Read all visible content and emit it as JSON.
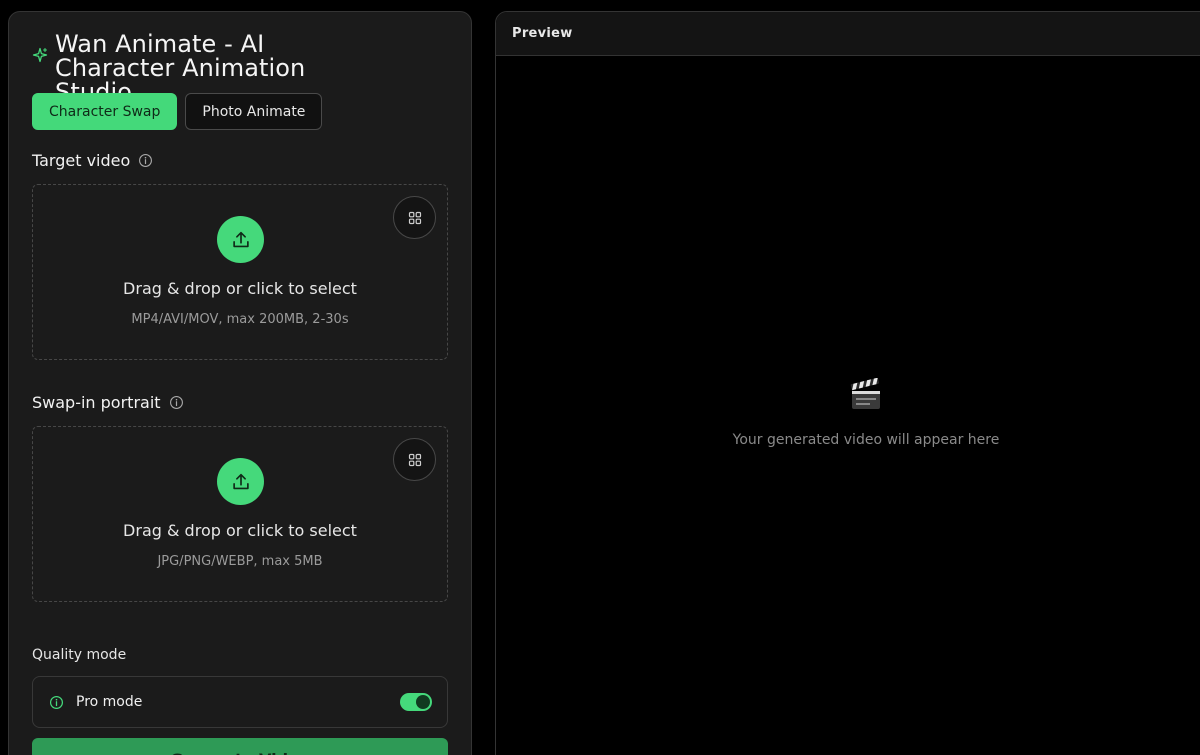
{
  "app": {
    "title": "Wan Animate - AI Character Animation Studio"
  },
  "tabs": [
    {
      "label": "Character Swap",
      "active": true
    },
    {
      "label": "Photo Animate",
      "active": false
    }
  ],
  "target_video": {
    "label": "Target video",
    "drop_text": "Drag & drop or click to select",
    "hint": "MP4/AVI/MOV, max 200MB, 2-30s"
  },
  "swap_portrait": {
    "label": "Swap-in portrait",
    "drop_text": "Drag & drop or click to select",
    "hint": "JPG/PNG/WEBP, max 5MB"
  },
  "quality": {
    "label": "Quality mode",
    "pro_mode_label": "Pro mode",
    "pro_mode_enabled": true
  },
  "generate": {
    "label": "Generate Video"
  },
  "preview": {
    "header": "Preview",
    "empty_icon": "clapperboard-icon",
    "empty_text": "Your generated video will appear here"
  },
  "colors": {
    "accent": "#45d97b",
    "panel": "#1b1b1b",
    "background": "#000000"
  }
}
